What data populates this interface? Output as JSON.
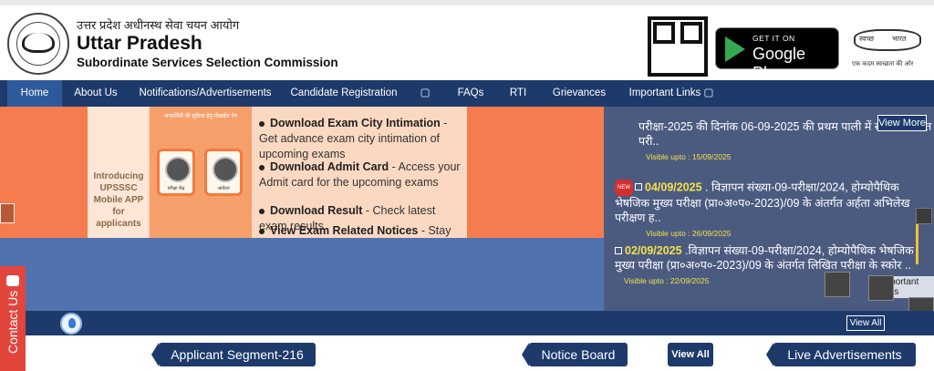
{
  "header": {
    "title_hindi": "उत्तर प्रदेश अधीनस्थ सेवा चयन आयोग",
    "title_en": "Uttar Pradesh",
    "subtitle_en": "Subordinate Services Selection Commission",
    "gplay_small": "GET IT ON",
    "gplay_big": "Google Play",
    "swachh_left": "स्वच्छ",
    "swachh_right": "भारत",
    "swachh_tag": "एक कदम स्वच्छता की ओर"
  },
  "nav": {
    "items": [
      {
        "label": "Home"
      },
      {
        "label": "About Us"
      },
      {
        "label": "Notifications/Advertisements"
      },
      {
        "label": "Candidate Registration"
      },
      {
        "label": "▢"
      },
      {
        "label": "FAQs"
      },
      {
        "label": "RTI"
      },
      {
        "label": "Grievances"
      },
      {
        "label": "Important Links ▢"
      }
    ]
  },
  "banner": {
    "intro": "Introducing UPSSSC Mobile APP for applicants",
    "phone_top": "अभ्यर्थियों की सुविधा हेतु मोबाईल ऐप",
    "card1": "परीक्षा केंद्र",
    "card2": "आवेदन",
    "features": [
      {
        "head": "Download Exam City Intimation",
        "rest": " - Get advance exam city intimation of upcoming exams"
      },
      {
        "head": "Download Admit Card",
        "rest": " - Access your Admit card for the upcoming exams"
      },
      {
        "head": "Download Result",
        "rest": " - Check latest exam results"
      },
      {
        "head": "View Exam Related Notices",
        "rest": " - Stay Updated"
      }
    ]
  },
  "notices": {
    "view_more": "View More",
    "items": [
      {
        "date": "",
        "text": "परीक्षा-2025 की दिनांक 06-09-2025 की प्रथम पाली में सम्पन्न लिखित परी..",
        "visible": "Visible upto : 15/09/2025"
      },
      {
        "badge": "NEW",
        "date": "04/09/2025",
        "text": " . विज्ञापन संख्या-09-परीक्षा/2024, होम्योपैथिक भेषजिक मुख्य परीक्षा (प्रा०अ०प०-2023)/09 के अंतर्गत अर्हता अभिलेख परीक्षण ह..",
        "visible": "Visible upto : 26/09/2025"
      },
      {
        "date": "02/09/2025",
        "text": " .विज्ञापन संख्या-09-परीक्षा/2024, होम्योपैथिक भेषजिक मुख्य परीक्षा (प्रा०अ०प०-2023)/09 के अंतर्गत लिखित परीक्षा के स्कोर ..",
        "visible": "Visible upto : 22/09/2025"
      }
    ],
    "important_gos": "Important Go's"
  },
  "band": {
    "view_all": "View All"
  },
  "bottom": {
    "applicant_segment": "Applicant Segment-216",
    "notice_board": "Notice Board",
    "view_all": "View All",
    "live_ads": "Live Advertisements"
  },
  "contact": {
    "label": "Contact Us"
  },
  "colors": {
    "nav": "#1d3a6b",
    "hero_orange": "#f57c4f",
    "hero_blue": "#5072ae",
    "notice_bg": "#4b5b80",
    "accent_yellow": "#f4e04d",
    "contact_red": "#e2453c"
  }
}
